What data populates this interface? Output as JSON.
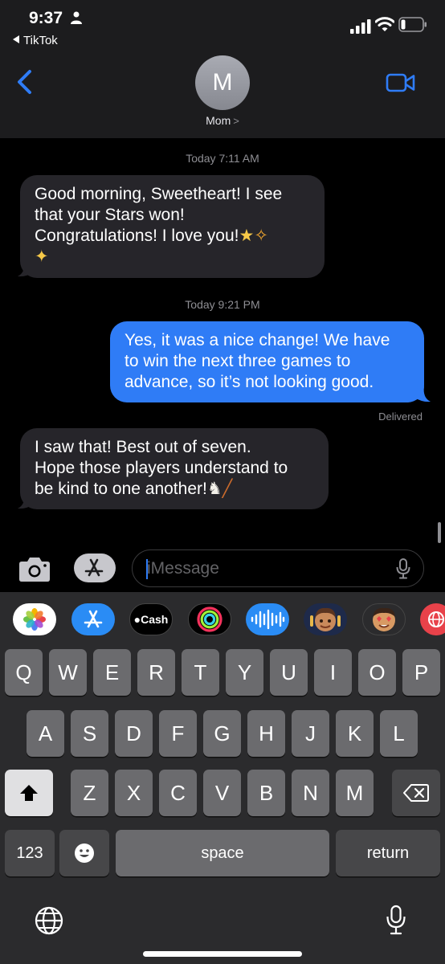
{
  "status_bar": {
    "time": "9:37",
    "back_app": "TikTok"
  },
  "header": {
    "avatar_initial": "M",
    "contact_name": "Mom",
    "contact_chevron": ">"
  },
  "messages": [
    {
      "type": "timestamp",
      "text": "Today 7:11 AM"
    },
    {
      "type": "incoming",
      "lines": [
        "Good morning, Sweetheart!  I see",
        "that your Stars won!",
        "Congratulations!  I love you!"
      ],
      "emojis": [
        "star-emoji",
        "dizzy-emoji",
        "glowing-star-emoji"
      ],
      "emoji_chars": [
        "★",
        "✧",
        "✦"
      ]
    },
    {
      "type": "timestamp",
      "text": "Today 9:21 PM"
    },
    {
      "type": "outgoing",
      "lines": [
        "Yes, it was a nice change! We have",
        "to win the next three games to",
        "advance, so it’s not looking good."
      ],
      "status": "Delivered"
    },
    {
      "type": "incoming",
      "lines": [
        "I saw that!  Best out of seven.",
        "Hope those players understand to",
        "be kind to one another!"
      ],
      "emojis": [
        "tooth-emoji",
        "hockey-emoji"
      ],
      "emoji_chars": [
        "♞",
        "╱"
      ]
    }
  ],
  "input_bar": {
    "placeholder": "iMessage"
  },
  "app_drawer": {
    "apps": [
      {
        "name": "photos-app-icon",
        "label": ""
      },
      {
        "name": "app-store-icon",
        "label": ""
      },
      {
        "name": "apple-cash-icon",
        "label": "Cash"
      },
      {
        "name": "activity-icon",
        "label": ""
      },
      {
        "name": "audio-message-icon",
        "label": ""
      },
      {
        "name": "memoji-icon",
        "label": ""
      },
      {
        "name": "memoji-stickers-icon",
        "label": ""
      },
      {
        "name": "web-search-icon",
        "label": ""
      }
    ]
  },
  "keyboard": {
    "row1": [
      "Q",
      "W",
      "E",
      "R",
      "T",
      "Y",
      "U",
      "I",
      "O",
      "P"
    ],
    "row2": [
      "A",
      "S",
      "D",
      "F",
      "G",
      "H",
      "J",
      "K",
      "L"
    ],
    "row3": [
      "Z",
      "X",
      "C",
      "V",
      "B",
      "N",
      "M"
    ],
    "numbers_label": "123",
    "space_label": "space",
    "return_label": "return"
  },
  "colors": {
    "sent_bubble": "#2f7cf6",
    "received_bubble": "#26252a",
    "accent": "#2f7cf6",
    "keyboard_bg": "#2b2b2d"
  }
}
